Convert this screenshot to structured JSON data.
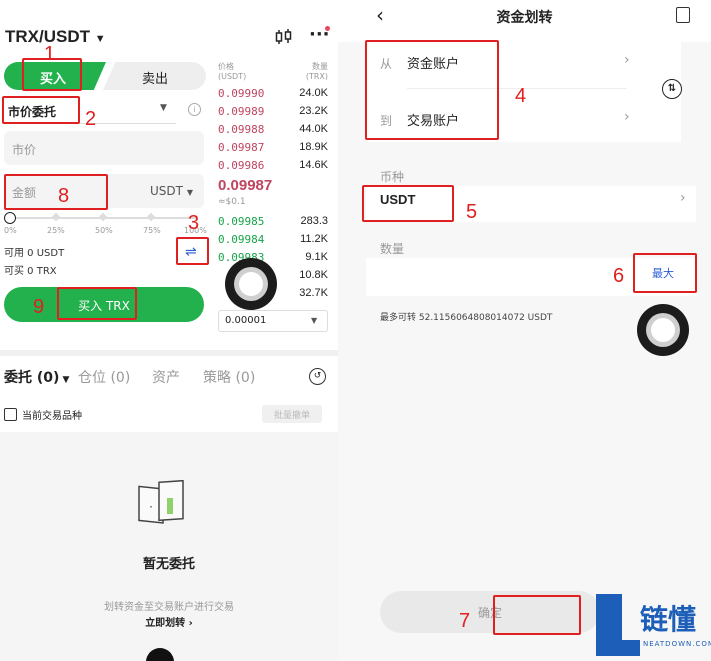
{
  "left": {
    "pair": "TRX/USDT",
    "tabs": {
      "buy": "买入",
      "sell": "卖出"
    },
    "order_type": "市价委托",
    "price_placeholder": "市价",
    "amount_placeholder": "金额",
    "amount_unit": "USDT",
    "slider_ticks": [
      "0%",
      "25%",
      "50%",
      "75%",
      "100%"
    ],
    "available": "可用 0 USDT",
    "buyable": "可买 0 TRX",
    "buy_button": "买入 TRX",
    "orderbook": {
      "price_header": "价格\n(USDT)",
      "qty_header": "数量\n(TRX)",
      "asks": [
        {
          "price": "0.09990",
          "qty": "24.0K"
        },
        {
          "price": "0.09989",
          "qty": "23.2K"
        },
        {
          "price": "0.09988",
          "qty": "44.0K"
        },
        {
          "price": "0.09987",
          "qty": "18.9K"
        },
        {
          "price": "0.09986",
          "qty": "14.6K"
        }
      ],
      "last_price": "0.09987",
      "last_price_fiat": "≈$0.1",
      "bids": [
        {
          "price": "0.09985",
          "qty": "283.3"
        },
        {
          "price": "0.09984",
          "qty": "11.2K"
        },
        {
          "price": "0.09983",
          "qty": "9.1K"
        },
        {
          "price": "",
          "qty": "10.8K"
        },
        {
          "price": "",
          "qty": "32.7K"
        }
      ],
      "precision": "0.00001"
    },
    "bottom_tabs": [
      "委托 (0)",
      "仓位 (0)",
      "资产",
      "策略 (0)"
    ],
    "current_pair_only": "当前交易品种",
    "batch_cancel": "批量撤单",
    "empty_title": "暂无委托",
    "empty_desc": "划转资金至交易账户进行交易",
    "transfer_now": "立即划转"
  },
  "right": {
    "title": "资金划转",
    "from_label": "从",
    "from_account": "资金账户",
    "to_label": "到",
    "to_account": "交易账户",
    "currency_label": "币种",
    "currency": "USDT",
    "amount_label": "数量",
    "max_button": "最大",
    "max_transferable": "最多可转 52.1156064808014072 USDT",
    "confirm_button": "确定"
  },
  "annotations": {
    "n1": "1",
    "n2": "2",
    "n3": "3",
    "n4": "4",
    "n5": "5",
    "n6": "6",
    "n7": "7",
    "n8": "8",
    "n9": "9"
  },
  "watermark": {
    "brand": "链懂",
    "domain": "NEATDOWN.COM"
  },
  "colors": {
    "buy_green": "#22b14c",
    "ask_red": "#c0445e",
    "bid_green": "#17a34a",
    "annotation_red": "#e02020",
    "link_blue": "#2a5bd7"
  }
}
